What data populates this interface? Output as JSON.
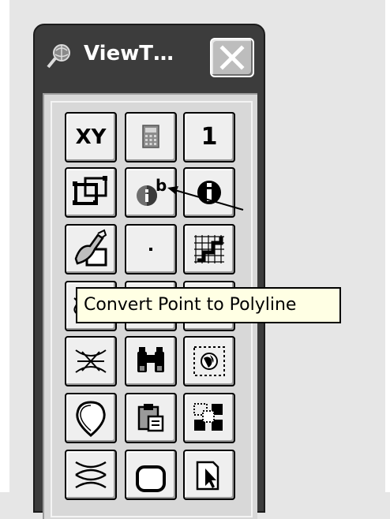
{
  "window": {
    "title": "ViewT…",
    "close_icon": "close-icon",
    "app_icon": "magnifier-globe-icon"
  },
  "tools": [
    {
      "name": "xy-tool",
      "label": "XY",
      "icon": "xy-text-icon"
    },
    {
      "name": "calculator-tool",
      "label": "",
      "icon": "calculator-icon"
    },
    {
      "name": "number-one-tool",
      "label": "1",
      "icon": "number-one-icon"
    },
    {
      "name": "select-objects-tool",
      "label": "",
      "icon": "select-rectangles-icon"
    },
    {
      "name": "info-b-tool",
      "label": "",
      "icon": "info-b-icon"
    },
    {
      "name": "info-tool",
      "label": "",
      "icon": "info-icon"
    },
    {
      "name": "edit-paint-tool",
      "label": "",
      "icon": "brush-edit-icon"
    },
    {
      "name": "point-tool",
      "label": "",
      "icon": "dot-icon"
    },
    {
      "name": "grid-polyline-tool",
      "label": "",
      "icon": "grid-step-icon"
    },
    {
      "name": "convert-point-to-polyline-tool",
      "label": "",
      "icon": "convert-point-to-polyline-icon"
    },
    {
      "name": "hidden-tool-2",
      "label": "",
      "icon": "blank-icon"
    },
    {
      "name": "hidden-tool-3",
      "label": "",
      "icon": "blank-icon"
    },
    {
      "name": "crossing-lines-tool",
      "label": "",
      "icon": "crossing-lines-icon"
    },
    {
      "name": "binoculars-tool",
      "label": "",
      "icon": "binoculars-icon"
    },
    {
      "name": "globe-selection-tool",
      "label": "",
      "icon": "globe-selection-icon"
    },
    {
      "name": "balloon-tool",
      "label": "",
      "icon": "balloon-icon"
    },
    {
      "name": "clipboard-tool",
      "label": "",
      "icon": "clipboard-icon"
    },
    {
      "name": "select-grid-tool",
      "label": "",
      "icon": "dotted-selection-icon"
    },
    {
      "name": "wave-lines-tool",
      "label": "",
      "icon": "wave-lines-icon"
    },
    {
      "name": "rounded-rectangle-tool",
      "label": "",
      "icon": "rounded-rectangle-icon"
    },
    {
      "name": "pointer-document-tool",
      "label": "",
      "icon": "pointer-document-icon"
    }
  ],
  "tooltip": {
    "text": "Convert Point to Polyline"
  },
  "annotation": {
    "arrow_icon": "pointer-arrow-icon"
  }
}
